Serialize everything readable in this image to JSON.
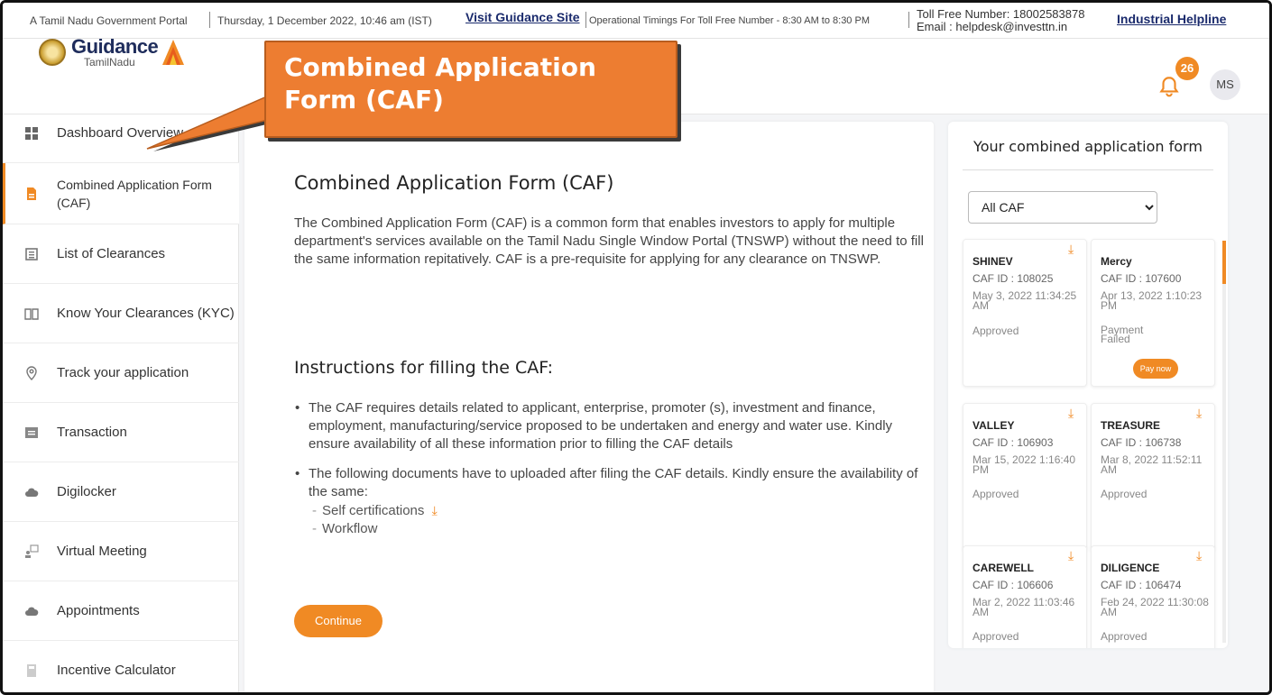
{
  "topbar": {
    "portal_text": "A Tamil Nadu Government Portal",
    "datetime": "Thursday, 1 December 2022, 10:46 am (IST)",
    "guidance_link": "Visit Guidance Site",
    "timings": "Operational Timings For Toll Free Number - 8:30 AM to 8:30 PM",
    "tollfree": "Toll Free Number: 18002583878",
    "email": "Email : helpdesk@investtn.in",
    "helpline_link": "Industrial Helpline"
  },
  "header": {
    "logo_main": "Guidance",
    "logo_sub": "TamilNadu",
    "notification_count": "26",
    "avatar_initials": "MS"
  },
  "callout": {
    "text": "Combined Application Form (CAF)"
  },
  "sidebar": {
    "items": [
      {
        "label": "Dashboard Overview",
        "icon": "grid-icon"
      },
      {
        "label": "Combined Application Form (CAF)",
        "icon": "document-icon",
        "active": true
      },
      {
        "label": "List of Clearances",
        "icon": "list-icon"
      },
      {
        "label": "Know Your Clearances (KYC)",
        "icon": "book-icon"
      },
      {
        "label": "Track your application",
        "icon": "location-pin-icon"
      },
      {
        "label": "Transaction",
        "icon": "transaction-icon"
      },
      {
        "label": "Digilocker",
        "icon": "cloud-icon"
      },
      {
        "label": "Virtual Meeting",
        "icon": "meeting-icon"
      },
      {
        "label": "Appointments",
        "icon": "cloud-icon"
      },
      {
        "label": "Incentive Calculator",
        "icon": "calculator-icon"
      }
    ]
  },
  "main": {
    "title": "Combined Application Form (CAF)",
    "intro": "The Combined Application Form (CAF) is a common form that enables investors to apply for multiple department's services available on the Tamil Nadu Single Window Portal (TNSWP) without the need to fill the same information repitatively. CAF is a pre-requisite for applying for any clearance on TNSWP.",
    "instructions_title": "Instructions for filling the CAF:",
    "instruction_1": "The CAF requires details related to applicant, enterprise, promoter (s), investment and finance, employment, manufacturing/service proposed to be undertaken and energy and water use. Kindly ensure availability of all these information prior to filling the CAF details",
    "instruction_2": "The following documents have to uploaded after filing the CAF details. Kindly ensure the availability of the same:",
    "doc_1": "Self certifications",
    "doc_2": "Workflow",
    "continue_label": "Continue"
  },
  "right_panel": {
    "title": "Your combined application form",
    "filter_selected": "All CAF",
    "cards": [
      {
        "name": "SHINEV",
        "caf_id": "CAF ID : 108025",
        "date": "May 3, 2022 11:34:25 AM",
        "status": "Approved"
      },
      {
        "name": "Mercy",
        "caf_id": "CAF ID : 107600",
        "date": "Apr 13, 2022 1:10:23 PM",
        "status": "Payment Failed",
        "action": "Pay now"
      },
      {
        "name": "VALLEY",
        "caf_id": "CAF ID : 106903",
        "date": "Mar 15, 2022 1:16:40 PM",
        "status": "Approved"
      },
      {
        "name": "TREASURE",
        "caf_id": "CAF ID : 106738",
        "date": "Mar 8, 2022 11:52:11 AM",
        "status": "Approved"
      },
      {
        "name": "CAREWELL",
        "caf_id": "CAF ID : 106606",
        "date": "Mar 2, 2022 11:03:46 AM",
        "status": "Approved"
      },
      {
        "name": "DILIGENCE",
        "caf_id": "CAF ID : 106474",
        "date": "Feb 24, 2022 11:30:08 AM",
        "status": "Approved"
      }
    ]
  },
  "colors": {
    "accent": "#f08a24",
    "callout": "#ed7d31",
    "navy": "#1a2a6c"
  }
}
